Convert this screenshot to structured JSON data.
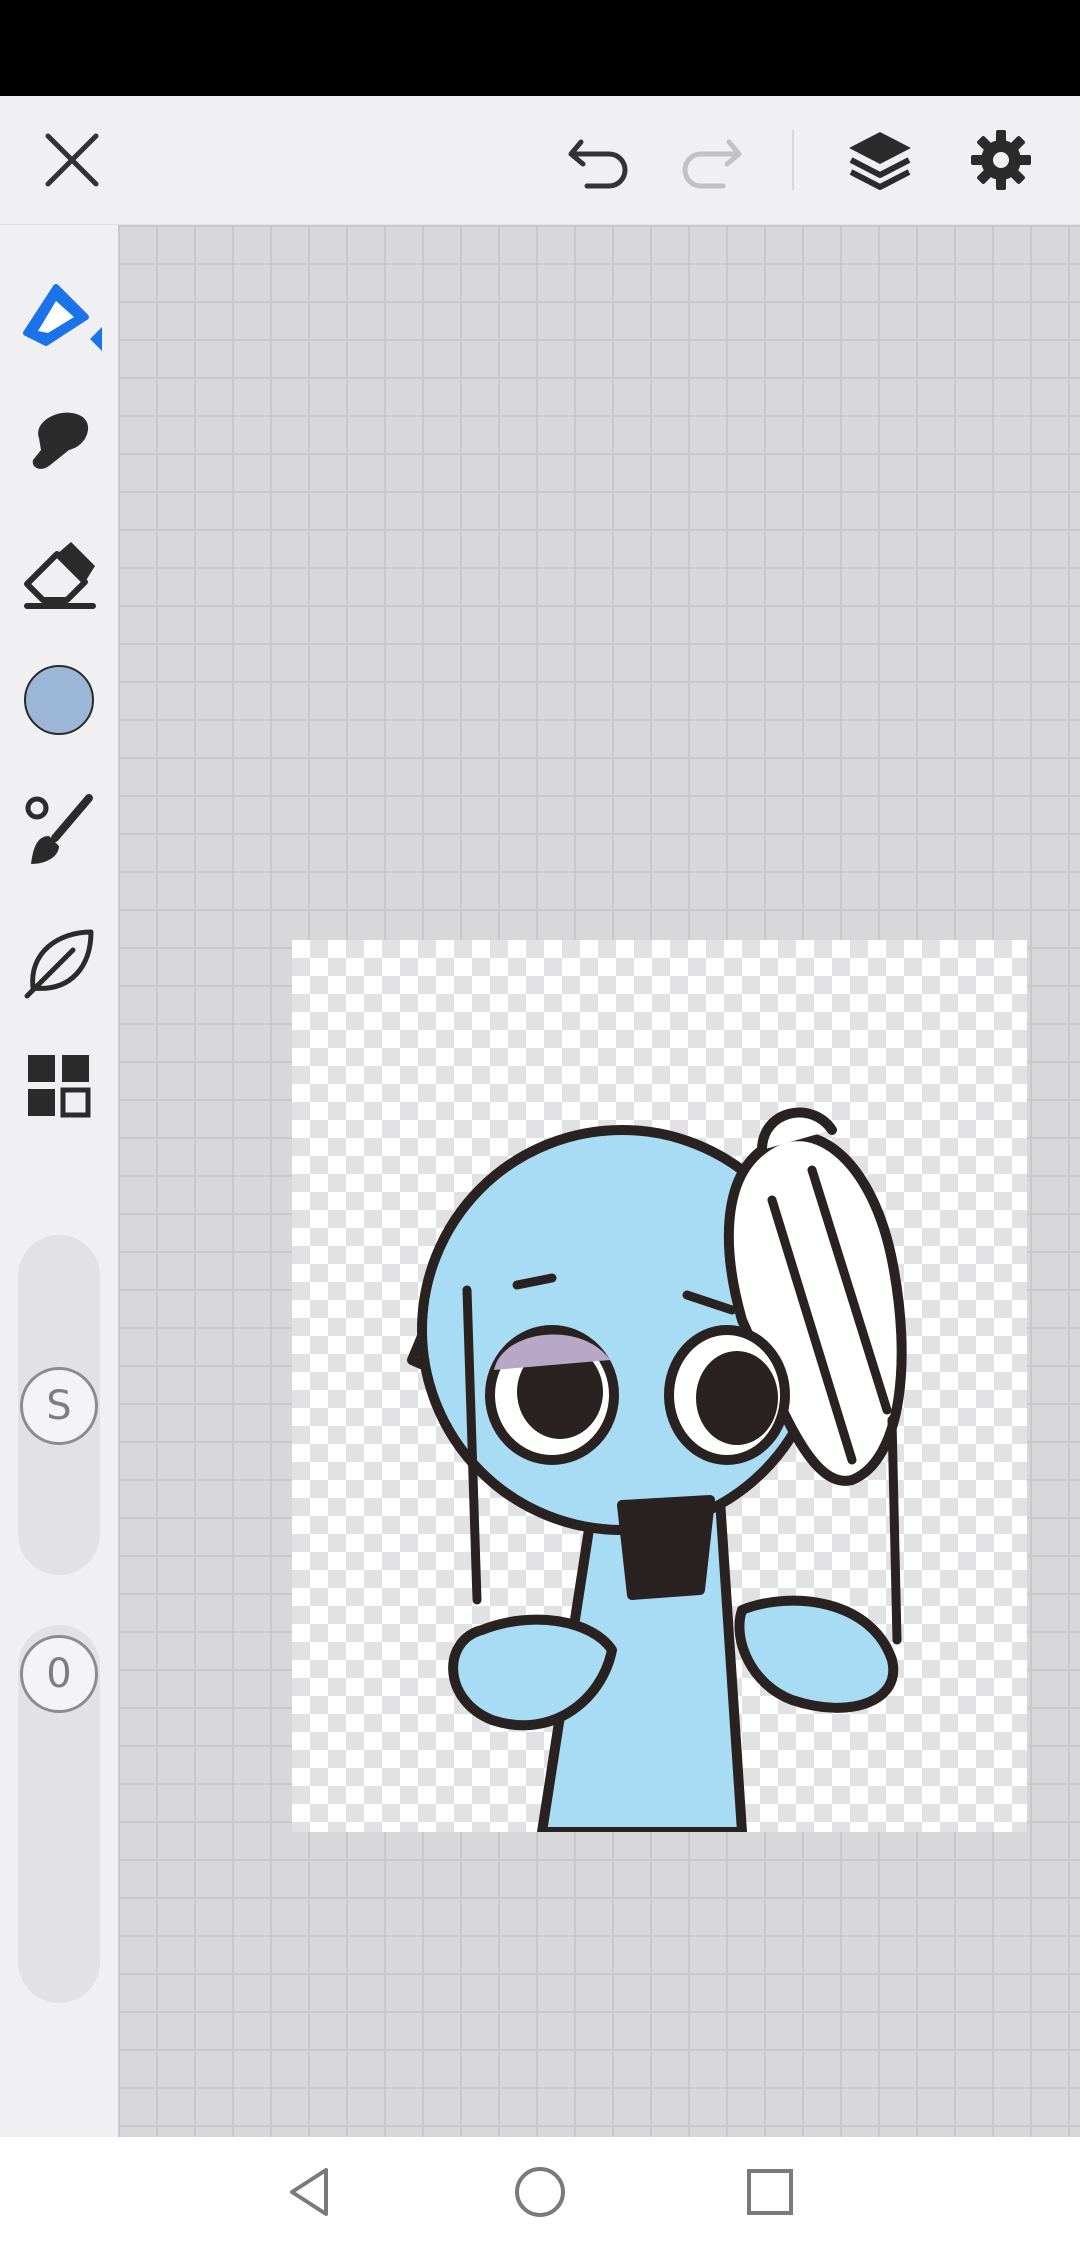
{
  "toolbar": {
    "close_icon": "close-icon",
    "undo_icon": "undo-icon",
    "redo_icon": "redo-icon",
    "layers_icon": "layers-icon",
    "settings_icon": "gear-icon"
  },
  "sidebar": {
    "tools": [
      "pen-tool",
      "smudge-tool",
      "eraser-tool",
      "color-picker",
      "brush-settings",
      "leaf-tool",
      "gallery-tool"
    ],
    "current_color": "#9bb6d6",
    "size_label": "S",
    "opacity_value": "0"
  },
  "colors": {
    "accent": "#1a73e8",
    "character_fill": "#a8dcf5",
    "outline": "#2a2220"
  }
}
